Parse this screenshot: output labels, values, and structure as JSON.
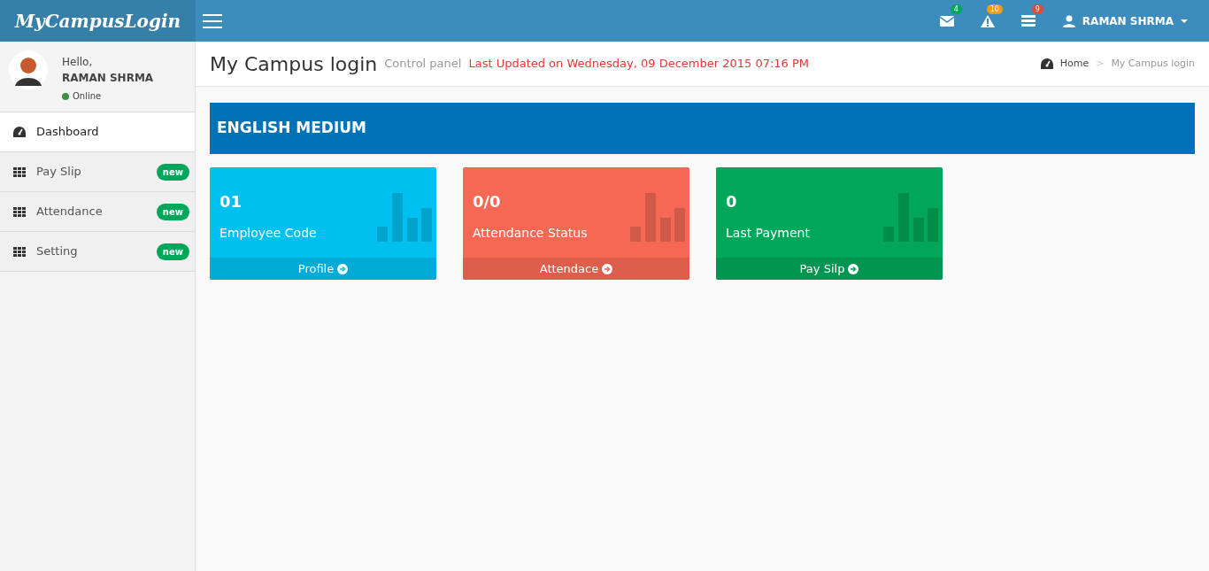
{
  "header": {
    "logo": "MyCampusLogin",
    "notifications": [
      {
        "kind": "mail",
        "count": "4",
        "color": "#00a65a"
      },
      {
        "kind": "warning",
        "count": "10",
        "color": "#f39c12"
      },
      {
        "kind": "tasks",
        "count": "9",
        "color": "#dd4b39"
      }
    ],
    "user": "RAMAN SHRMA"
  },
  "sidebar": {
    "greeting": "Hello,",
    "user": "RAMAN SHRMA",
    "status": "Online",
    "items": [
      {
        "label": "Dashboard",
        "kind": "dashboard",
        "selected": true
      },
      {
        "label": "Pay Slip",
        "kind": "grid",
        "selected": false,
        "badge": "new"
      },
      {
        "label": "Attendance",
        "kind": "grid",
        "selected": false,
        "badge": "new"
      },
      {
        "label": "Setting",
        "kind": "grid",
        "selected": false,
        "badge": "new"
      }
    ]
  },
  "content_header": {
    "title": "My Campus login",
    "subtitle": "Control panel",
    "updated": "Last Updated on Wednesday, 09 December 2015 07:16 PM",
    "breadcrumb": [
      "Home",
      "My Campus login"
    ],
    "breadcrumb_separator": ">"
  },
  "section_title": "ENGLISH MEDIUM",
  "tiles": [
    {
      "value": "01",
      "label": "Employee Code",
      "link": "Profile",
      "color": "#00c0ef"
    },
    {
      "value": "0/0",
      "label": "Attendance Status",
      "link": "Attendace",
      "color": "#f56954"
    },
    {
      "value": "0",
      "label": "Last Payment",
      "link": "Pay Silp",
      "color": "#00a65a"
    }
  ]
}
